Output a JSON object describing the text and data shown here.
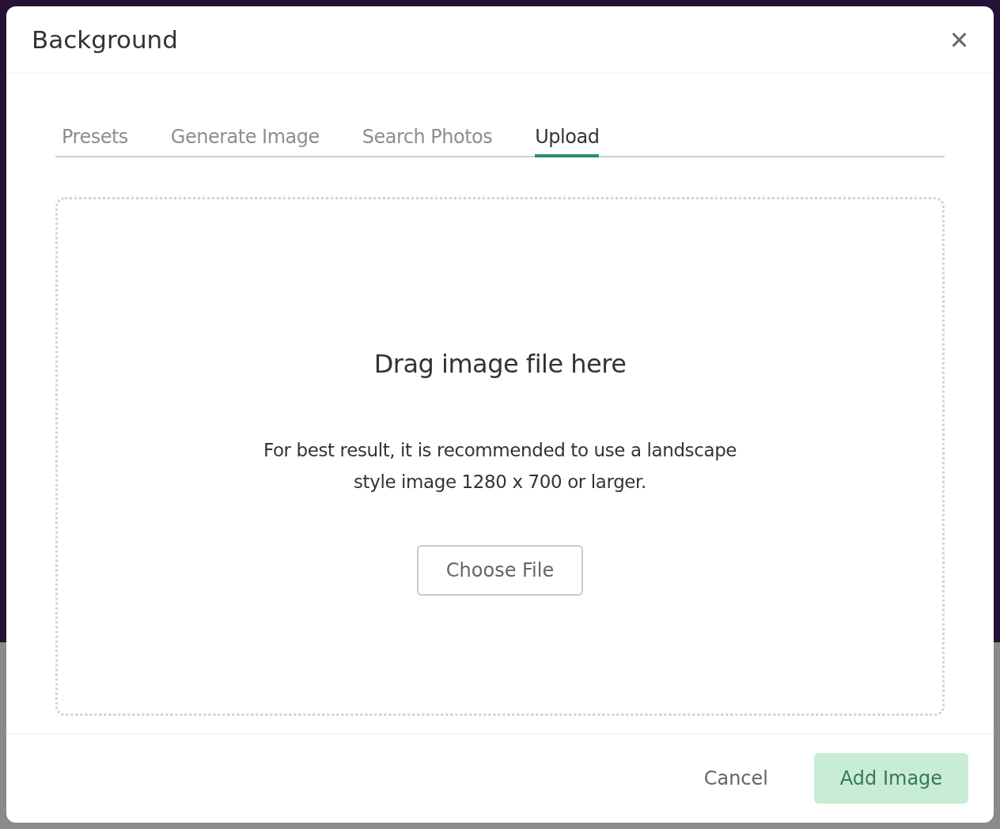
{
  "dialog": {
    "title": "Background",
    "close_icon": "×"
  },
  "tabs": [
    {
      "label": "Presets",
      "selected": false
    },
    {
      "label": "Generate Image",
      "selected": false
    },
    {
      "label": "Search Photos",
      "selected": false
    },
    {
      "label": "Upload",
      "selected": true
    }
  ],
  "dropzone": {
    "heading": "Drag image file here",
    "hint": "For best result, it is recommended to use a landscape style image 1280 x 700 or larger.",
    "button": "Choose File"
  },
  "footer": {
    "buttons": [
      {
        "label": "Cancel",
        "kind": "text",
        "disabled": false
      },
      {
        "label": "Add Image",
        "kind": "primary",
        "disabled": true
      }
    ]
  }
}
